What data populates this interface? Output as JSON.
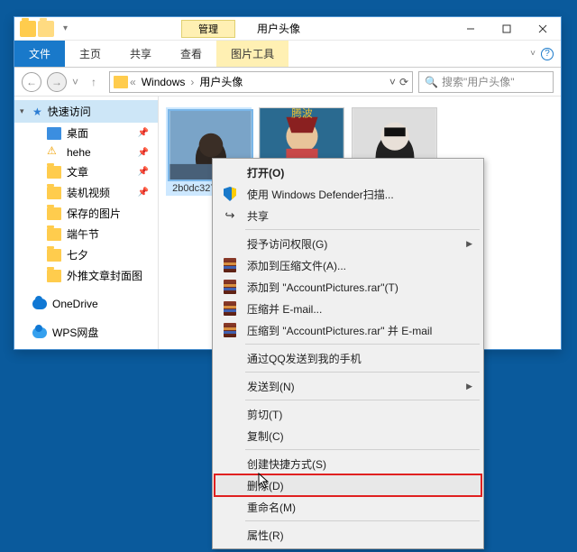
{
  "window": {
    "contextual_tab_group": "管理",
    "title": "用户头像"
  },
  "ribbon": {
    "file": "文件",
    "home": "主页",
    "share": "共享",
    "view": "查看",
    "picture_tools": "图片工具"
  },
  "addressbar": {
    "crumb1": "Windows",
    "crumb2": "用户头像"
  },
  "search": {
    "placeholder": "搜索\"用户头像\""
  },
  "sidebar": {
    "quick_access": "快速访问",
    "items": [
      {
        "label": "桌面",
        "icon": "desktop",
        "pin": true
      },
      {
        "label": "hehe",
        "icon": "warn",
        "pin": true
      },
      {
        "label": "文章",
        "icon": "folder",
        "pin": true
      },
      {
        "label": "装机视频",
        "icon": "folder",
        "pin": true
      },
      {
        "label": "保存的图片",
        "icon": "folder",
        "pin": false
      },
      {
        "label": "端午节",
        "icon": "folder",
        "pin": false
      },
      {
        "label": "七夕",
        "icon": "folder",
        "pin": false
      },
      {
        "label": "外推文章封面图",
        "icon": "folder",
        "pin": false
      }
    ],
    "onedrive": "OneDrive",
    "wps": "WPS网盘"
  },
  "thumb_label": "2b0dc327f1e…6",
  "context_menu": {
    "open": "打开(O)",
    "defender": "使用 Windows Defender扫描...",
    "share": "共享",
    "access": "授予访问权限(G)",
    "rar_add": "添加到压缩文件(A)...",
    "rar_add_named": "添加到 \"AccountPictures.rar\"(T)",
    "rar_email": "压缩并 E-mail...",
    "rar_email_named": "压缩到 \"AccountPictures.rar\" 并 E-mail",
    "qq_send": "通过QQ发送到我的手机",
    "send_to": "发送到(N)",
    "cut": "剪切(T)",
    "copy": "复制(C)",
    "shortcut": "创建快捷方式(S)",
    "delete": "删除(D)",
    "rename": "重命名(M)",
    "properties": "属性(R)"
  }
}
